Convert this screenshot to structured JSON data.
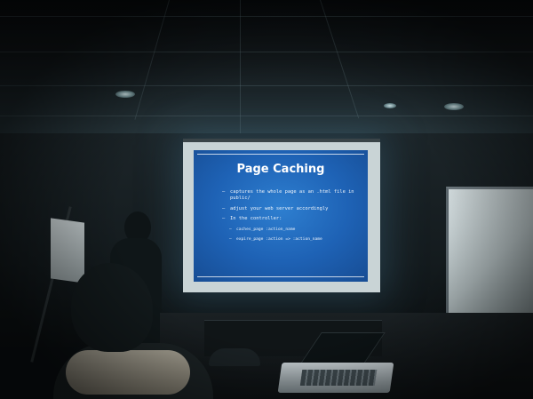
{
  "slide": {
    "title": "Page Caching",
    "bullets": [
      "captures the whole page as an .html file in public/",
      "adjust your web server accordingly",
      "In the controller:"
    ],
    "sub_bullets": [
      "caches_page :action_name",
      "expire_page :action => :action_name"
    ]
  },
  "colors": {
    "slide_background": "#1e62b5",
    "slide_text": "#eef4fb",
    "room": "#0b0f12"
  }
}
